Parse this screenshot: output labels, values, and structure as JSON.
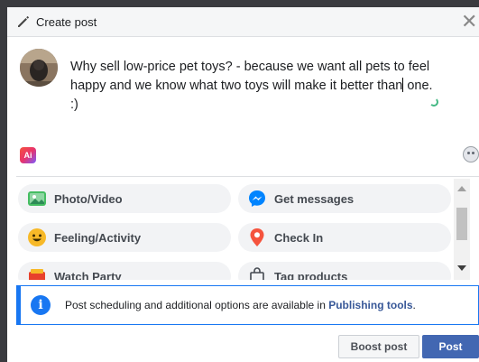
{
  "dialog": {
    "title": "Create post",
    "close_label": "✕"
  },
  "composer": {
    "text_line1": "Why sell low-price pet toys? - because we want all pets to feel",
    "text_line2_a": "happy and we know what two toys will make it better than",
    "text_line2_b": "one.",
    "text_line3": ":)"
  },
  "tools": {
    "app_icon_text": "Ai"
  },
  "options": [
    {
      "label": "Photo/Video",
      "icon": "photo-video-icon"
    },
    {
      "label": "Get messages",
      "icon": "messenger-icon"
    },
    {
      "label": "Feeling/Activity",
      "icon": "smiley-icon"
    },
    {
      "label": "Check In",
      "icon": "location-pin-icon"
    },
    {
      "label": "Watch Party",
      "icon": "watch-party-icon"
    },
    {
      "label": "Tag products",
      "icon": "shopping-bag-icon"
    }
  ],
  "info": {
    "icon": "i",
    "text": "Post scheduling and additional options are available in ",
    "link": "Publishing tools",
    "suffix": "."
  },
  "actions": {
    "boost_label": "Boost post",
    "post_label": "Post"
  },
  "colors": {
    "accent": "#1877f2",
    "post_button": "#4267b2",
    "link": "#385898"
  }
}
